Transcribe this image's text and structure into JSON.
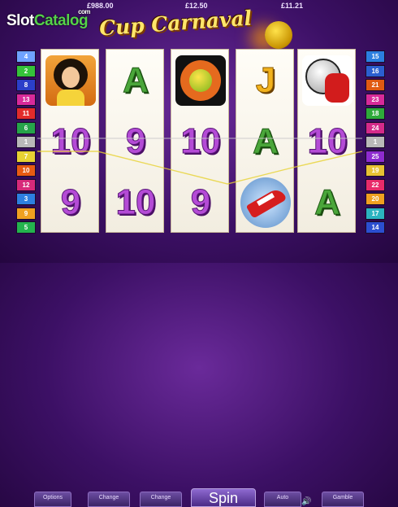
{
  "watermark": {
    "part1": "Slot",
    "part2": "Catalog",
    "suffix": "com"
  },
  "game_title": "Cup Carnaval",
  "top_values": {
    "left": "£988.00",
    "middle": "£12.50",
    "right": "£11.21"
  },
  "left_paylines": [
    {
      "num": "4",
      "color": "#6fa3ff"
    },
    {
      "num": "2",
      "color": "#35c23a"
    },
    {
      "num": "8",
      "color": "#2b3fc9"
    },
    {
      "num": "13",
      "color": "#d82a9a"
    },
    {
      "num": "11",
      "color": "#e22b2b"
    },
    {
      "num": "6",
      "color": "#26a34a"
    },
    {
      "num": "1",
      "color": "#b9b9b9"
    },
    {
      "num": "7",
      "color": "#e7d233"
    },
    {
      "num": "10",
      "color": "#e85b12"
    },
    {
      "num": "12",
      "color": "#d72a7a"
    },
    {
      "num": "3",
      "color": "#2d7fe0"
    },
    {
      "num": "9",
      "color": "#f0a020"
    },
    {
      "num": "5",
      "color": "#24b34e"
    }
  ],
  "right_paylines": [
    {
      "num": "15",
      "color": "#2b7fe0"
    },
    {
      "num": "16",
      "color": "#2b5fd0"
    },
    {
      "num": "21",
      "color": "#e05a12"
    },
    {
      "num": "23",
      "color": "#d82a9a"
    },
    {
      "num": "18",
      "color": "#2eaa3a"
    },
    {
      "num": "24",
      "color": "#d42a8a"
    },
    {
      "num": "1",
      "color": "#b9b9b9"
    },
    {
      "num": "25",
      "color": "#8e2bd0"
    },
    {
      "num": "19",
      "color": "#e7c233"
    },
    {
      "num": "22",
      "color": "#e82b6a"
    },
    {
      "num": "20",
      "color": "#f0a020"
    },
    {
      "num": "17",
      "color": "#2bb3c0"
    },
    {
      "num": "14",
      "color": "#2b4fd0"
    }
  ],
  "reels": [
    [
      {
        "kind": "dancer"
      },
      {
        "kind": "text",
        "value": "10",
        "style": "num"
      },
      {
        "kind": "text",
        "value": "9",
        "style": "num"
      }
    ],
    [
      {
        "kind": "text",
        "value": "A",
        "style": "A"
      },
      {
        "kind": "text",
        "value": "9",
        "style": "num"
      },
      {
        "kind": "text",
        "value": "10",
        "style": "num"
      }
    ],
    [
      {
        "kind": "ball"
      },
      {
        "kind": "text",
        "value": "10",
        "style": "num"
      },
      {
        "kind": "text",
        "value": "9",
        "style": "num"
      }
    ],
    [
      {
        "kind": "text",
        "value": "J",
        "style": "J"
      },
      {
        "kind": "text",
        "value": "A",
        "style": "A"
      },
      {
        "kind": "boot"
      }
    ],
    [
      {
        "kind": "glove"
      },
      {
        "kind": "text",
        "value": "10",
        "style": "num"
      },
      {
        "kind": "text",
        "value": "A",
        "style": "A"
      }
    ]
  ],
  "buttons": {
    "options": "Options",
    "change1": "Change",
    "change2": "Change",
    "spin": "Spin",
    "auto": "Auto",
    "gamble": "Gamble"
  }
}
